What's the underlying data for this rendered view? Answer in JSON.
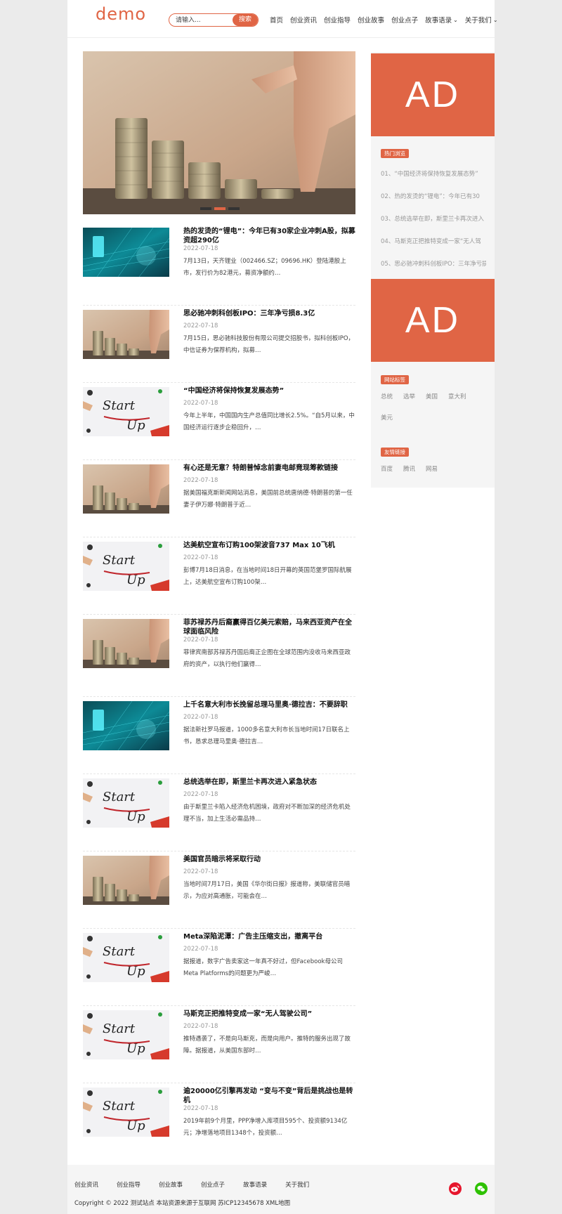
{
  "header": {
    "logo": "demo",
    "search": {
      "placeholder": "请输入...",
      "button": "搜索"
    },
    "nav": [
      {
        "label": "首页"
      },
      {
        "label": "创业资讯"
      },
      {
        "label": "创业指导"
      },
      {
        "label": "创业故事"
      },
      {
        "label": "创业点子"
      },
      {
        "label": "故事语录",
        "chevron": "chevron-down-icon"
      },
      {
        "label": "关于我们",
        "chevron": "chevron-down-icon"
      }
    ]
  },
  "slider": {
    "image": "coin-stacks-hand-photo",
    "dots": 3,
    "active_dot": 2
  },
  "articles": [
    {
      "title": "热的发烫的“锂电”：今年已有30家企业冲刺A股，拟募资超290亿",
      "date": "2022-07-18",
      "desc": "7月13日，天齐锂业（002466.SZ；09696.HK）登陆港股上市，发行价为82港元，募资净额约…",
      "image": "teal-tech"
    },
    {
      "title": "思必驰冲刺科创板IPO：三年净亏损8.3亿",
      "date": "2022-07-18",
      "desc": "7月15日，思必驰科技股份有限公司提交招股书，拟科创板IPO，中信证券为保荐机构，拟募…",
      "image": "coins"
    },
    {
      "title": "“中国经济将保持恢复发展态势”",
      "date": "2022-07-18",
      "desc": "今年上半年，中国国内生产总值同比增长2.5%。“自5月以来，中国经济运行逐步企稳回升，…",
      "image": "startup"
    },
    {
      "title": "有心还是无意？特朗普悼念前妻电邮竟现筹款链接",
      "date": "2022-07-18",
      "desc": "据美国福克斯新闻网站消息，美国前总统唐纳德·特朗普的第一任妻子伊万娜·特朗普于近…",
      "image": "coins"
    },
    {
      "title": "达美航空宣布订购100架波音737 Max 10飞机",
      "date": "2022-07-18",
      "desc": "彭博7月18日消息，在当地时间18日开幕的英国范堡罗国际航展上，达美航空宣布订购100架…",
      "image": "startup"
    },
    {
      "title": "菲苏禄苏丹后裔赢得百亿美元索赔，马来西亚资产在全球面临风险",
      "date": "2022-07-18",
      "desc": "菲律宾南部苏禄苏丹国后裔正企图在全球范围内没收马来西亚政府的资产，以执行他们赢得…",
      "image": "coins"
    },
    {
      "title": "上千名意大利市长挽留总理马里奥·德拉吉：不要辞职",
      "date": "2022-07-18",
      "desc": "据法新社罗马报道，1000多名意大利市长当地时间17日联名上书，恳求总理马里奥·德拉吉…",
      "image": "teal-tech"
    },
    {
      "title": "总统选举在即，斯里兰卡再次进入紧急状态",
      "date": "2022-07-18",
      "desc": "由于斯里兰卡陷入经济危机困境，政府对不断加深的经济危机处理不当，加上生活必需品持…",
      "image": "startup"
    },
    {
      "title": "美国官员暗示将采取行动",
      "date": "2022-07-18",
      "desc": "当地时间7月17日，美国《华尔街日报》报道称，美联储官员暗示，为应对高通胀，可能会在…",
      "image": "coins"
    },
    {
      "title": "Meta深陷泥潭：广告主压缩支出，撤离平台",
      "date": "2022-07-18",
      "desc": "据报道，数字广告卖家这一年真不好过，但Facebook母公司Meta Platforms的问题更为严峻…",
      "image": "startup"
    },
    {
      "title": "马斯克正把推特变成一家“无人驾驶公司”",
      "date": "2022-07-18",
      "desc": "推特遇袭了，不是向马斯克，而是向用户。推特的服务出现了故障。据报道，从美国东部时…",
      "image": "startup"
    },
    {
      "title": "逾20000亿引擎再发动 “变与不变”背后是挑战也是转机",
      "date": "2022-07-18",
      "desc": "2019年前9个月里，PPP净增入库项目595个、投资额9134亿元；净增落地项目1348个，投资额…",
      "image": "startup"
    }
  ],
  "sidebar": {
    "ad1": "AD",
    "ad2": "AD",
    "hot_label": "热门浏览",
    "hot": [
      "01、“中国经济将保持恢复发展态势”",
      "02、热的发烫的“锂电”：今年已有30",
      "03、总统选举在即，斯里兰卡再次进入",
      "04、马斯克正把推特变成一家“无人驾",
      "05、思必驰冲刺科创板IPO：三年净亏损"
    ],
    "tags_label": "网站标签",
    "tags": [
      "总统",
      "选举",
      "美国",
      "意大利",
      "美元"
    ],
    "links_label": "友情链接",
    "links": [
      "百度",
      "腾讯",
      "网易"
    ]
  },
  "footer": {
    "links": [
      "创业资讯",
      "创业指导",
      "创业故事",
      "创业点子",
      "故事语录",
      "关于我们"
    ],
    "copyright": "Copyright © 2022 测试站点 本站资源来源于互联网 苏ICP12345678 XML地图",
    "social": [
      {
        "name": "weibo-icon",
        "color": "#e6162d"
      },
      {
        "name": "wechat-icon",
        "color": "#2dc100"
      }
    ]
  },
  "colors": {
    "accent": "#e06545"
  }
}
